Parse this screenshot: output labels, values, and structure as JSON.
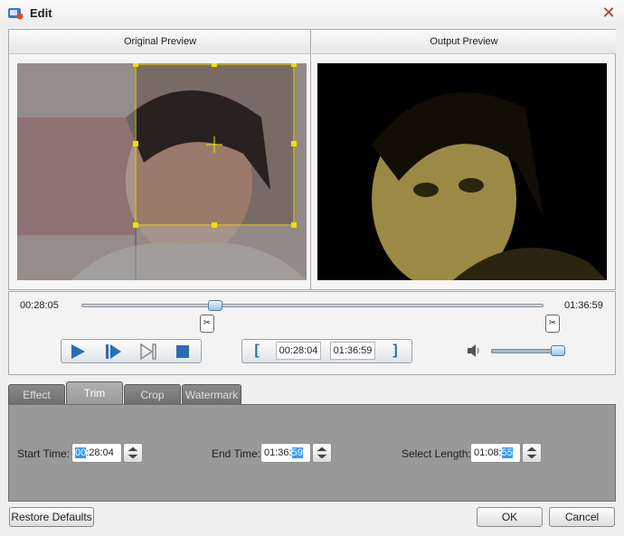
{
  "window": {
    "title": "Edit",
    "close_icon": "close-icon"
  },
  "preview": {
    "original_label": "Original Preview",
    "output_label": "Output Preview"
  },
  "timeline": {
    "current_time": "00:28:05",
    "total_time": "01:36:59",
    "position_fraction": 0.29
  },
  "trim_bar": {
    "start": "00:28:04",
    "end": "01:36:59"
  },
  "volume": {
    "level_fraction": 0.9
  },
  "tabs": [
    {
      "label": "Effect"
    },
    {
      "label": "Trim"
    },
    {
      "label": "Crop"
    },
    {
      "label": "Watermark"
    }
  ],
  "trim": {
    "start_label": "Start Time:",
    "start_hl": "00",
    "start_rest": ":28:04",
    "end_label": "End Time:",
    "end_rest": "01:36:",
    "end_hl": "59",
    "length_label": "Select Length:",
    "length_rest": "01:08:",
    "length_hl": "55"
  },
  "footer": {
    "restore_label": "Restore Defaults",
    "ok_label": "OK",
    "cancel_label": "Cancel"
  },
  "colors": {
    "accent": "#3399ff",
    "crop_box": "#f0e000",
    "tab_panel": "#999999"
  }
}
